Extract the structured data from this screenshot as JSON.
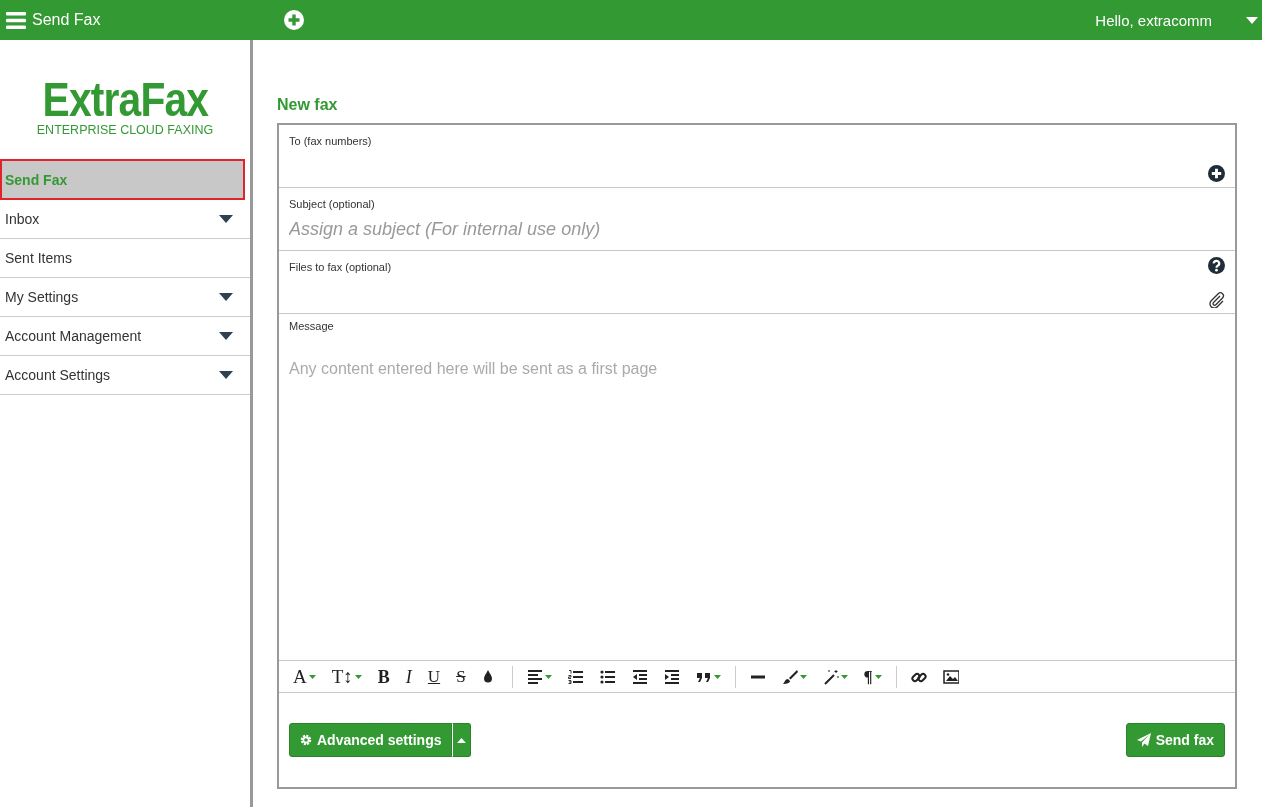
{
  "topbar": {
    "title": "Send Fax",
    "greeting": "Hello, extracomm"
  },
  "logo": {
    "name": "ExtraFax",
    "tagline": "ENTERPRISE CLOUD FAXING"
  },
  "sidebar": {
    "items": [
      {
        "label": "Send Fax",
        "selected": true,
        "expandable": false
      },
      {
        "label": "Inbox",
        "selected": false,
        "expandable": true
      },
      {
        "label": "Sent Items",
        "selected": false,
        "expandable": false
      },
      {
        "label": "My Settings",
        "selected": false,
        "expandable": true
      },
      {
        "label": "Account Management",
        "selected": false,
        "expandable": true
      },
      {
        "label": "Account Settings",
        "selected": false,
        "expandable": true
      }
    ]
  },
  "form": {
    "heading": "New fax",
    "fields": [
      {
        "kind": "recipients",
        "label": "To (fax numbers)"
      },
      {
        "kind": "text",
        "label": "Subject (optional)",
        "placeholder": "Assign a subject (For internal use only)"
      },
      {
        "kind": "files",
        "label": "Files to fax (optional)"
      },
      {
        "kind": "message",
        "label": "Message",
        "placeholder": "Any content entered here will be sent as a first page"
      }
    ],
    "toolbar": [
      [
        {
          "kind": "font",
          "label": "A",
          "dropdown": true
        },
        {
          "kind": "size",
          "label": "T↕",
          "dropdown": true
        },
        {
          "kind": "bold",
          "label": "B",
          "dropdown": false
        },
        {
          "kind": "italic",
          "label": "I",
          "dropdown": false
        },
        {
          "kind": "underline",
          "label": "U",
          "dropdown": false
        },
        {
          "kind": "strike",
          "label": "S",
          "dropdown": false
        },
        {
          "kind": "drop",
          "dropdown": false
        }
      ],
      [
        {
          "kind": "align",
          "dropdown": true
        },
        {
          "kind": "ol",
          "dropdown": false
        },
        {
          "kind": "ul",
          "dropdown": false
        },
        {
          "kind": "outdent",
          "dropdown": false
        },
        {
          "kind": "indent",
          "dropdown": false
        },
        {
          "kind": "quote",
          "dropdown": true
        }
      ],
      [
        {
          "kind": "hr",
          "dropdown": false
        },
        {
          "kind": "brush",
          "dropdown": true
        },
        {
          "kind": "wand",
          "dropdown": true
        },
        {
          "kind": "paragraph",
          "label": "¶",
          "dropdown": true
        }
      ],
      [
        {
          "kind": "link",
          "dropdown": false
        },
        {
          "kind": "image",
          "dropdown": false
        }
      ]
    ],
    "advanced_button": "Advanced settings",
    "send_button": "Send fax"
  }
}
